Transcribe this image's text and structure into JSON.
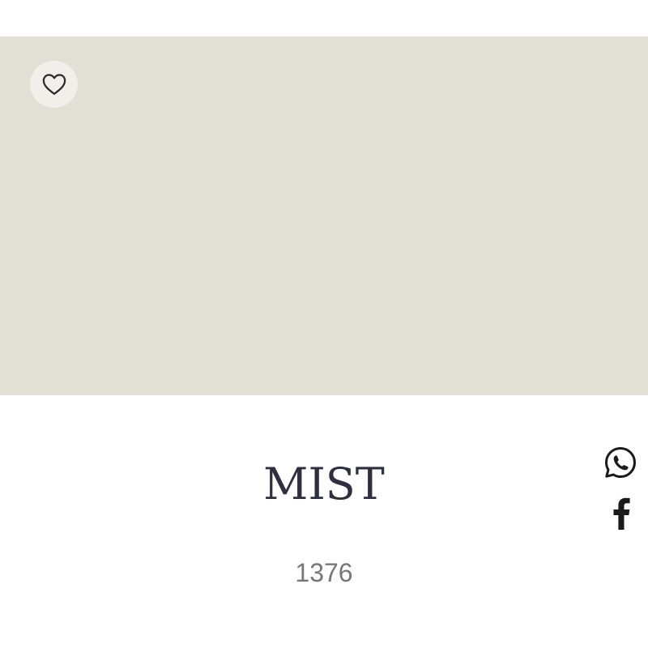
{
  "swatch": {
    "color": "#e2dfd4"
  },
  "favorite": {
    "icon": "heart-outline-icon"
  },
  "product": {
    "name": "MIST",
    "code": "1376"
  },
  "share": {
    "whatsapp_icon": "whatsapp-icon",
    "facebook_icon": "facebook-icon"
  },
  "colors": {
    "name_text": "#2e3040",
    "code_text": "#777777",
    "icon": "#1a1a1a",
    "favorite_bg": "#f1efe9"
  }
}
